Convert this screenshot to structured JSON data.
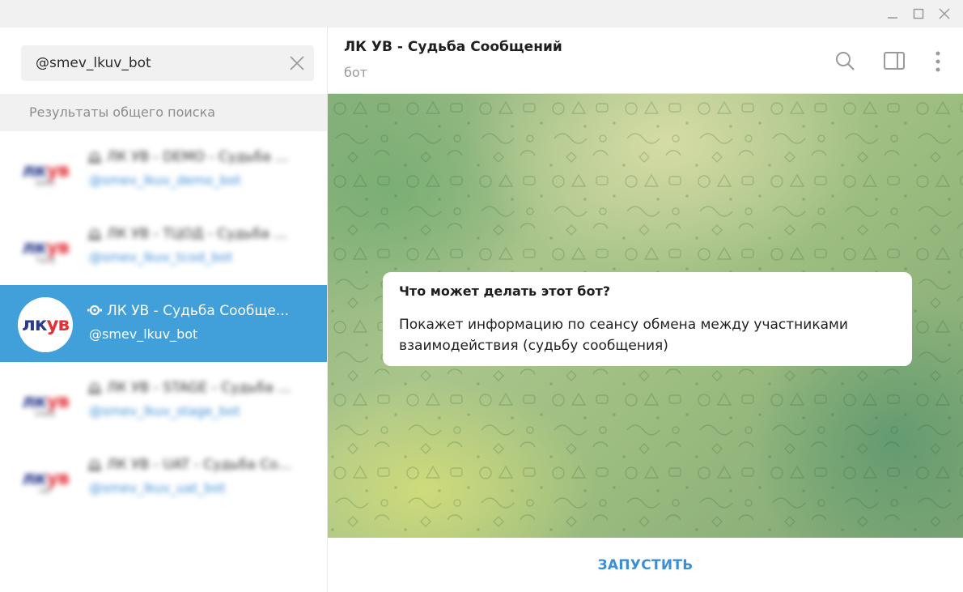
{
  "window": {
    "controls": [
      "minimize-icon",
      "maximize-icon",
      "close-icon"
    ]
  },
  "search": {
    "value": "@smev_lkuv_bot"
  },
  "results": {
    "header": "Результаты общего поиска",
    "items": [
      {
        "name": "ЛК УВ - DEMO - Судьба ...",
        "handle": "@smev_lkuv_demo_bot",
        "avatar_sub": "DEMO",
        "blurred": true
      },
      {
        "name": "ЛК УВ - ТЦОД - Судьба ...",
        "handle": "@smev_lkuv_tcod_bot",
        "avatar_sub": "ТЦОД",
        "blurred": true
      },
      {
        "name": "ЛК УВ - Судьба Сообще...",
        "handle": "@smev_lkuv_bot",
        "avatar_sub": "",
        "blurred": false
      },
      {
        "name": "ЛК УВ - STAGE - Судьба ...",
        "handle": "@smev_lkuv_stage_bot",
        "avatar_sub": "STAGE",
        "blurred": true
      },
      {
        "name": "ЛК УВ - UAT - Судьба Со...",
        "handle": "@smev_lkuv_uat_bot",
        "avatar_sub": "UAT",
        "blurred": true
      }
    ],
    "logo": {
      "part1": "лк",
      "part2": "ув"
    }
  },
  "chat": {
    "title": "ЛК УВ - Судьба Сообщений",
    "status": "бот",
    "bubble": {
      "title": "Что может делать этот бот?",
      "text": "Покажет информацию по сеансу обмена между участниками взаимодействия (судьбу сообщения)"
    },
    "start_label": "ЗАПУСТИТЬ"
  },
  "colors": {
    "accent": "#419fd9",
    "link": "#3c8ed6",
    "logo_blue": "#2a3a8c",
    "logo_red": "#e13239"
  }
}
